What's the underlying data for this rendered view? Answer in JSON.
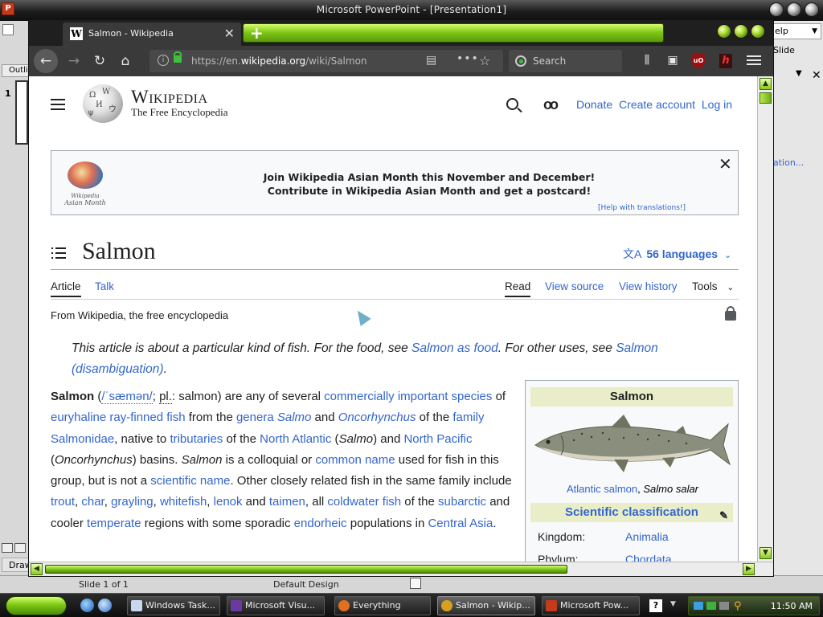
{
  "ppt": {
    "title": "Microsoft PowerPoint - [Presentation1]",
    "outline_tab": "Outli",
    "slide_number": "1",
    "draw_label": "Draw",
    "right_help": "elp",
    "right_slide": "Slide",
    "right_link": "ation...",
    "status_slide": "Slide 1 of 1",
    "status_design": "Default Design"
  },
  "firefox": {
    "tab_title": "Salmon - Wikipedia",
    "tab_favicon": "W",
    "url_prefix": "https://en.",
    "url_domain": "wikipedia.org",
    "url_path": "/wiki/Salmon",
    "search_placeholder": "Search",
    "ublock_label": "uO",
    "ext_label": "h"
  },
  "wiki": {
    "wordmark": "Wikipedia",
    "tagline": "The Free Encyclopedia",
    "donate": "Donate",
    "create_account": "Create account",
    "login": "Log in",
    "banner_line1": "Join Wikipedia Asian Month this November and December!",
    "banner_line2": "Contribute in Wikipedia Asian Month and get a postcard!",
    "banner_help": "[Help with translations!]",
    "banner_logo_caption1": "Wikipedia",
    "banner_logo_caption2": "Asian Month",
    "title": "Salmon",
    "languages": "56 languages",
    "tab_article": "Article",
    "tab_talk": "Talk",
    "tab_read": "Read",
    "tab_view_source": "View source",
    "tab_view_history": "View history",
    "tab_tools": "Tools",
    "from": "From Wikipedia, the free encyclopedia",
    "hatnote": {
      "t1": "This article is about a particular kind of fish. For the food, see ",
      "l1": "Salmon as food",
      "t2": ". For other uses, see ",
      "l2": "Salmon (disambiguation)",
      "t3": "."
    },
    "lead": {
      "b": "Salmon",
      "s1": " (",
      "ipa": "/ˈsæmən/",
      "s2": "; ",
      "pl": "pl.",
      "s3": ": salmon) are any of several ",
      "l1": "commercially important species",
      "s4": " of ",
      "l2": "euryhaline ray-finned fish",
      "s5": " from the ",
      "l3": "genera",
      "s6": " ",
      "l4": "Salmo",
      "s7": " and ",
      "l5": "Oncorhynchus",
      "s8": " of the ",
      "l6": "family Salmonidae",
      "s9": ", native to ",
      "l7": "tributaries",
      "s10": " of the ",
      "l8": "North Atlantic",
      "s11": " (",
      "i1": "Salmo",
      "s12": ") and ",
      "l9": "North Pacific",
      "s13": " (",
      "i2": "Oncorhynchus",
      "s14": ") basins. ",
      "i3": "Salmon",
      "s15": " is a colloquial or ",
      "l10": "common name",
      "s16": " used for fish in this group, but is not a ",
      "l11": "scientific name",
      "s17": ". Other closely related fish in the same family include ",
      "l12": "trout",
      "s18": ", ",
      "l13": "char",
      "s19": ", ",
      "l14": "grayling",
      "s20": ", ",
      "l15": "whitefish",
      "s21": ", ",
      "l16": "lenok",
      "s22": " and ",
      "l17": "taimen",
      "s23": ", all ",
      "l18": "coldwater fish",
      "s24": " of the ",
      "l19": "subarctic",
      "s25": " and cooler ",
      "l20": "temperate",
      "s26": " regions with some sporadic ",
      "l21": "endorheic",
      "s27": " populations in ",
      "l22": "Central Asia",
      "s28": "."
    },
    "infobox": {
      "name": "Salmon",
      "caption_link": "Atlantic salmon",
      "caption_sep": ", ",
      "caption_sci": "Salmo salar",
      "sci_class": "Scientific classification",
      "kingdom_label": "Kingdom:",
      "kingdom_value": "Animalia",
      "phylum_label": "Phylum:",
      "phylum_value": "Chordata"
    }
  },
  "taskbar": {
    "items": [
      "Windows Task...",
      "Microsoft Visu...",
      "Everything",
      "Salmon - Wikip...",
      "Microsoft Pow..."
    ],
    "help_icon": "?",
    "clock": "11:50 AM"
  },
  "colors": {
    "accent_green": "#7bc415",
    "wiki_link": "#3366cc"
  }
}
